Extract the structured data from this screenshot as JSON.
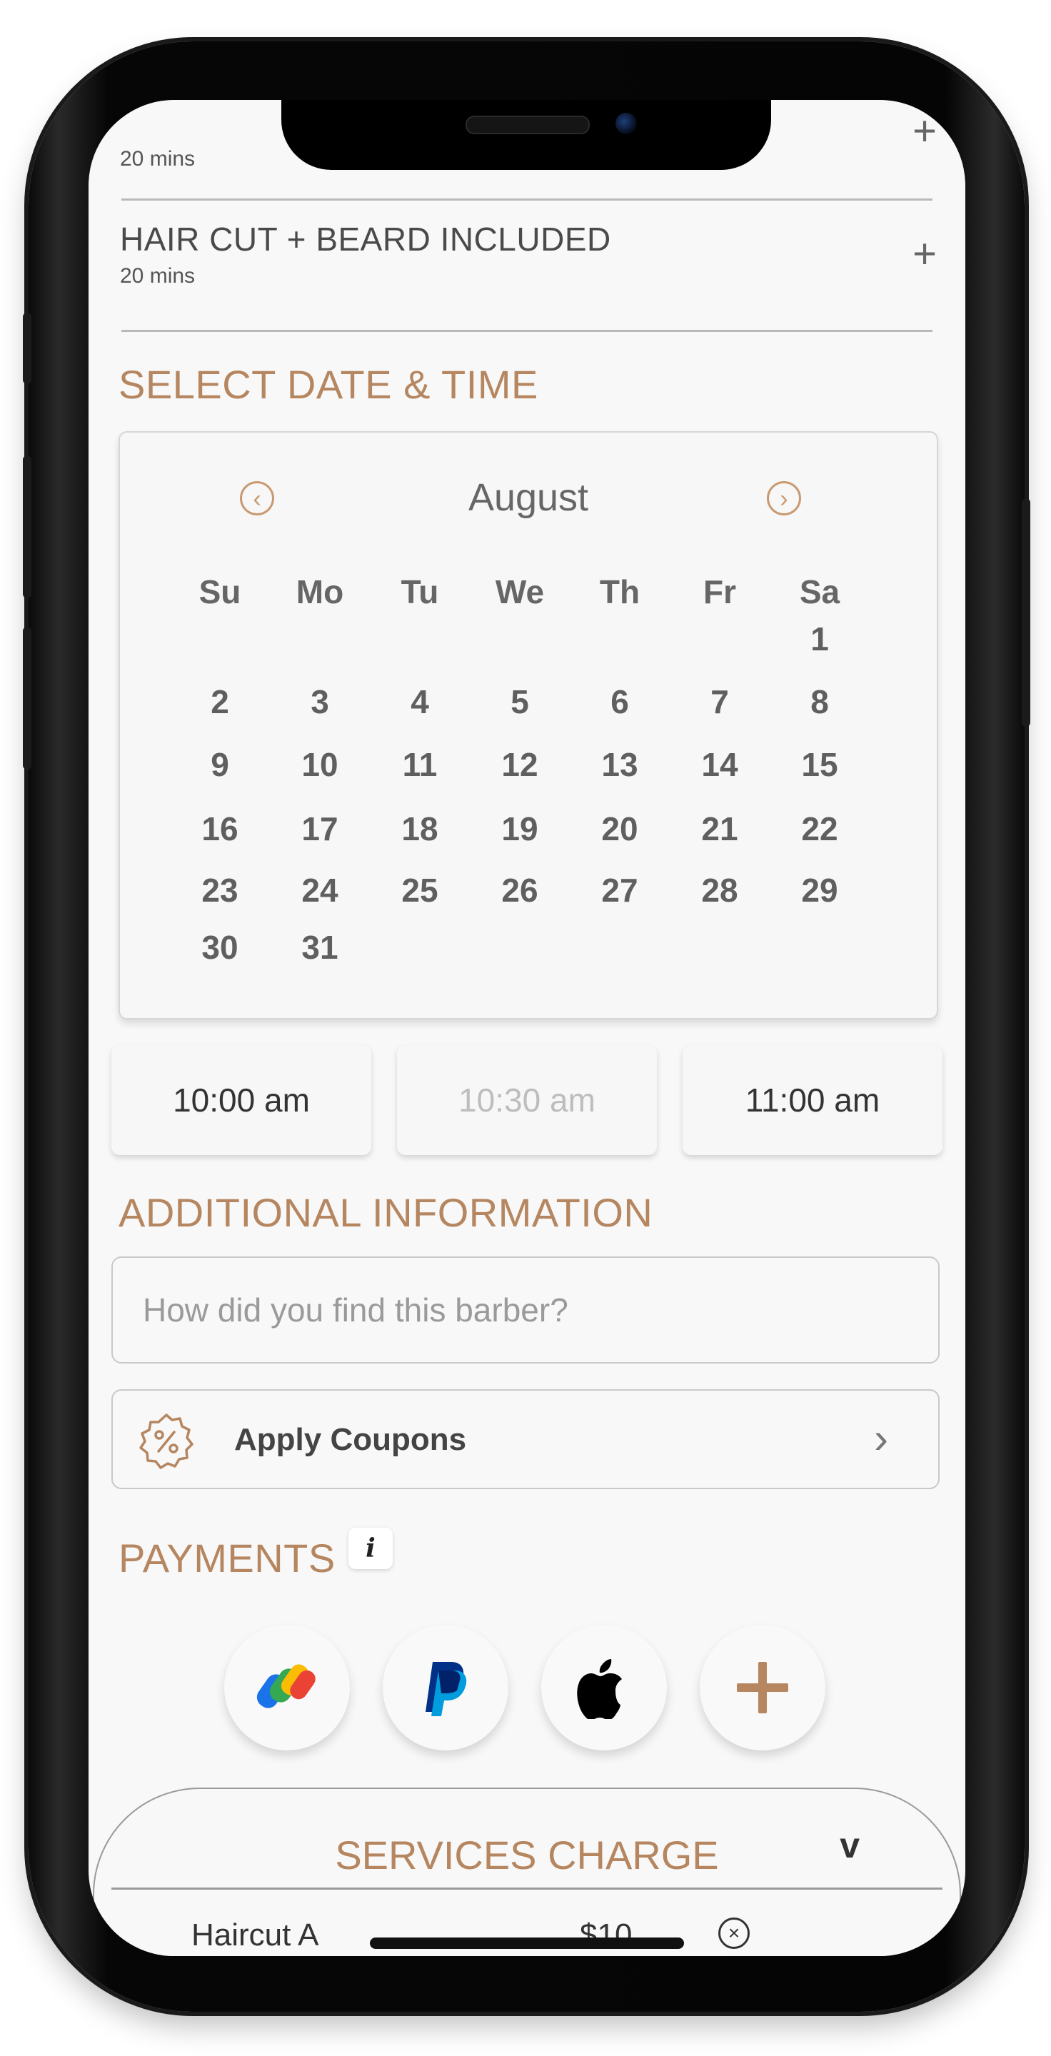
{
  "services": [
    {
      "title": "",
      "duration": "20 mins"
    },
    {
      "title": "HAIR CUT + BEARD INCLUDED",
      "duration": "20 mins"
    }
  ],
  "sections": {
    "date_time": "SELECT DATE & TIME",
    "additional": "ADDITIONAL INFORMATION",
    "payments": "PAYMENTS"
  },
  "calendar": {
    "month": "August",
    "weekdays": [
      "Su",
      "Mo",
      "Tu",
      "We",
      "Th",
      "Fr",
      "Sa"
    ],
    "first_weekday_index": 6,
    "days_in_month": 31
  },
  "time_slots": [
    {
      "label": "10:00 am",
      "available": true
    },
    {
      "label": "10:30 am",
      "available": false
    },
    {
      "label": "11:00 am",
      "available": true
    }
  ],
  "additional_info": {
    "placeholder": "How did you find this barber?",
    "value": ""
  },
  "coupon": {
    "label": "Apply Coupons"
  },
  "payments": {
    "info_label": "i",
    "methods": [
      "google-pay-icon",
      "paypal-icon",
      "apple-pay-icon",
      "add-payment-icon"
    ]
  },
  "services_charge": {
    "title": "SERVICES CHARGE",
    "partial_item_name": "Haircut A",
    "partial_item_price": "$10"
  },
  "colors": {
    "accent": "#b5865f",
    "text": "#4a4a4a",
    "background": "#f8f8f8"
  }
}
